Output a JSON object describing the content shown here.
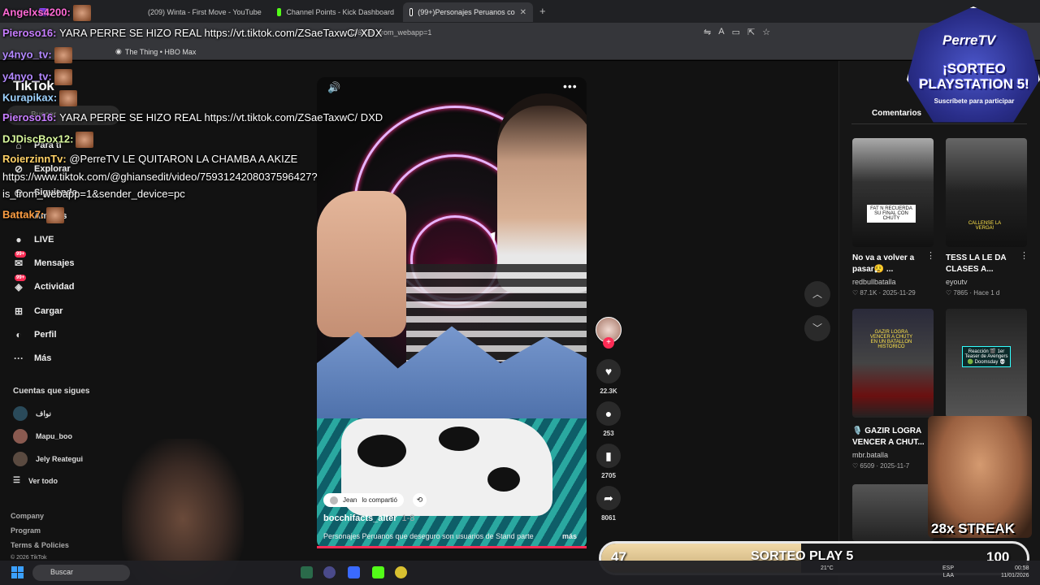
{
  "browser": {
    "tabs": [
      {
        "label": "",
        "active": false,
        "color": "#9147ff"
      },
      {
        "label": "(209) Winta - First Move - YouTube",
        "active": false,
        "color": "#ff0000"
      },
      {
        "label": "Channel Points - Kick Dashboard",
        "active": false,
        "color": "#53fc18"
      },
      {
        "label": "(99+)Personajes Peruanos co",
        "active": true,
        "color": "#ffffff"
      }
    ],
    "new_tab": "+",
    "url": "1368?is_from_webapp=1",
    "bookmarks": [
      "The Thing • HBO Max"
    ]
  },
  "tiktok": {
    "logo": "TikTok",
    "search_placeholder": "Buscar",
    "nav": [
      {
        "label": "Para ti",
        "icon": "home-icon"
      },
      {
        "label": "Explorar",
        "icon": "compass-icon"
      },
      {
        "label": "Siguiendo",
        "icon": "following-icon"
      },
      {
        "label": "Amigos",
        "icon": "friends-icon"
      },
      {
        "label": "LIVE",
        "icon": "live-icon"
      },
      {
        "label": "Mensajes",
        "icon": "messages-icon",
        "badge": "99+"
      },
      {
        "label": "Actividad",
        "icon": "activity-icon",
        "badge": "99+"
      },
      {
        "label": "Cargar",
        "icon": "upload-icon"
      },
      {
        "label": "Perfil",
        "icon": "profile-icon"
      },
      {
        "label": "Más",
        "icon": "more-icon"
      }
    ],
    "following_title": "Cuentas que sigues",
    "following": [
      "نواف",
      "Mapu_boo",
      "Jely Reategui"
    ],
    "see_all": "Ver todo",
    "footer": [
      "Company",
      "Program",
      "Terms & Policies",
      "© 2026 TikTok"
    ],
    "video": {
      "shared_by": "Jean",
      "shared_text": "lo compartió",
      "author": "bocchifacts_alter",
      "date": "1-8",
      "description": "Personajes Peruanos que deseguro son usuarios de Stand parte",
      "more": "más",
      "likes": "22.3K",
      "comments": "253",
      "saves": "2705",
      "shares": "8061"
    },
    "comments_tab": "Comentarios",
    "related": [
      {
        "title": "No va a volver a pasar😮‍💨 ...",
        "user": "redbullbatalla",
        "stats": "♡ 87.1K · 2025-11-29",
        "caption": "FAT N RECUERDA SU FINAL CON CHUTY"
      },
      {
        "title": "TESS LA LE DA CLASES A...",
        "user": "eyoutv",
        "stats": "♡ 7865 · Hace 1 d",
        "caption": "CALLENSE LA VERGA!"
      },
      {
        "title": "🎙️ GAZIR LOGRA VENCER A CHUT...",
        "user": "mbr.batalla",
        "stats": "♡ 6509 · 2025-11-7",
        "caption": "GAZIR LOGRA VENCER A CHUTY EN UN BATALLON HISTORICO"
      },
      {
        "title": "",
        "user": "",
        "stats": "",
        "caption": "Reacción 🎬 1er Teaser de Avengers 🟢 Doomsday 💀"
      }
    ]
  },
  "stream": {
    "chat": [
      {
        "user": "Angelxs4200:",
        "text": "",
        "color": "#ff6ad5",
        "emote": true
      },
      {
        "user": "Pieroso16:",
        "text": "YARA PERRE SE HIZO REAL https://vt.tiktok.com/ZSaeTaxwC/ XDX",
        "color": "#c77dff"
      },
      {
        "user": "y4nyo_tv:",
        "text": "",
        "color": "#b388ff",
        "emote": true
      },
      {
        "user": "y4nyo_tv:",
        "text": "",
        "color": "#b388ff",
        "emote": true
      },
      {
        "user": "Kurapikax:",
        "text": "",
        "color": "#9fd3ff",
        "emote": true
      },
      {
        "user": "Pieroso16:",
        "text": "YARA PERRE SE HIZO REAL https://vt.tiktok.com/ZSaeTaxwC/ DXD",
        "color": "#c77dff"
      },
      {
        "user": "DJDiscBox12:",
        "text": "",
        "color": "#d9f99d",
        "emote": true
      },
      {
        "user": "RoierzinnTv:",
        "text": "@PerreTV LE QUITARON LA CHAMBA A AKIZE",
        "color": "#ffd166"
      },
      {
        "user": "",
        "text": "https://www.tiktok.com/@ghiansedit/video/7593124208037596427?",
        "color": "#ffffff"
      },
      {
        "user": "",
        "text": "is_from_webapp=1&sender_device=pc",
        "color": "#ffffff"
      },
      {
        "user": "Battak7:",
        "text": "",
        "color": "#ff9f43",
        "emote": true
      }
    ],
    "promo": {
      "brand": "PerreTV",
      "line1": "¡SORTEO",
      "line2": "PLAYSTATION 5!",
      "sub": "Suscríbete para participar"
    },
    "streak": "28x STREAK",
    "goal": {
      "current": "47",
      "label": "SORTEO PLAY 5",
      "target": "100",
      "progress": 0.47
    }
  },
  "taskbar": {
    "search": "Buscar",
    "weather": "21°C",
    "lang": "ESP",
    "lang2": "LAA",
    "time": "00:58",
    "date": "11/01/2026"
  }
}
